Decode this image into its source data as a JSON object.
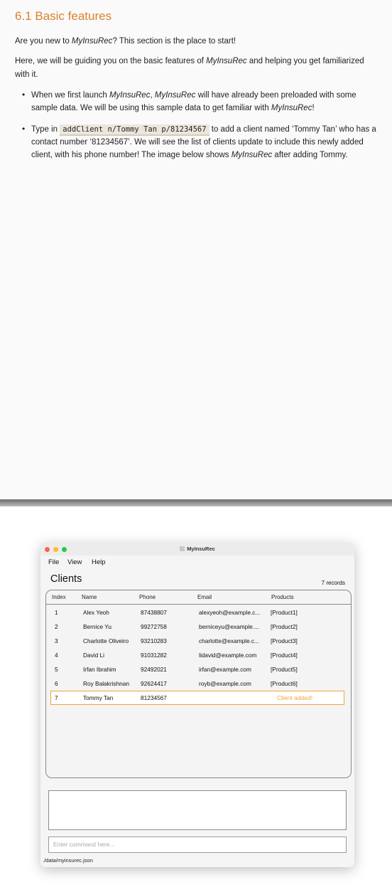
{
  "doc": {
    "heading": "6.1 Basic features",
    "p1_pre": "Are you new to ",
    "p1_em": "MyInsuRec",
    "p1_post": "? This section is the place to start!",
    "p2_pre": "Here, we will be guiding you on the basic features of ",
    "p2_em": "MyInsuRec",
    "p2_post": " and helping you get familiarized with it.",
    "b1_pre": "When we first launch ",
    "b1_em1": "MyInsuRec",
    "b1_mid1": ", ",
    "b1_em2": "MyInsuRec",
    "b1_mid2": " will have already been preloaded with some sample data. We will be using this sample data to get familiar with ",
    "b1_em3": "MyInsuRec",
    "b1_post": "!",
    "b2_pre": "Type in ",
    "b2_code": "addClient n/Tommy Tan p/81234567",
    "b2_mid": " to add a client named ‘Tommy Tan’ who has a contact number ‘81234567’. We will see the list of clients update to include this newly added client, with his phone number! The image below shows ",
    "b2_em": "MyInsuRec",
    "b2_post": " after adding Tommy."
  },
  "app": {
    "title": "MyInsuRec",
    "menus": [
      "File",
      "View",
      "Help"
    ],
    "panel_title": "Clients",
    "record_count": "7 records",
    "columns": [
      "Index",
      "Name",
      "Phone",
      "Email",
      "Products"
    ],
    "rows": [
      {
        "index": "1",
        "name": "Alex Yeoh",
        "phone": "87438807",
        "email": "alexyeoh@example.c...",
        "products": "[Product1]"
      },
      {
        "index": "2",
        "name": "Bernice Yu",
        "phone": "99272758",
        "email": "berniceyu@example....",
        "products": "[Product2]"
      },
      {
        "index": "3",
        "name": "Charlotte Oliveiro",
        "phone": "93210283",
        "email": "charlotte@example.c...",
        "products": "[Product3]"
      },
      {
        "index": "4",
        "name": "David Li",
        "phone": "91031282",
        "email": "lidavid@example.com",
        "products": "[Product4]"
      },
      {
        "index": "5",
        "name": "Irfan Ibrahim",
        "phone": "92492021",
        "email": "irfan@example.com",
        "products": "[Product5]"
      },
      {
        "index": "6",
        "name": "Roy Balakrishnan",
        "phone": "92624417",
        "email": "royb@example.com",
        "products": "[Product6]"
      },
      {
        "index": "7",
        "name": "Tommy Tan",
        "phone": "81234567",
        "email": "",
        "products": ""
      }
    ],
    "status_message": "Client added!",
    "command_placeholder": "Enter command here...",
    "file_path": "./data/myinsurec.json",
    "colors": {
      "accent": "#f0a43a",
      "heading": "#d9822b",
      "close": "#fe5f57",
      "minimize": "#febc2e",
      "maximize": "#28c840"
    }
  }
}
